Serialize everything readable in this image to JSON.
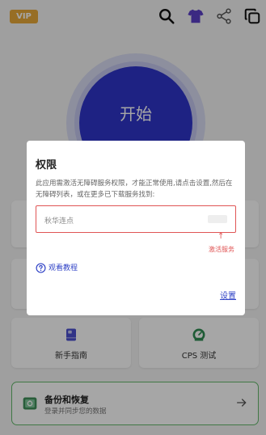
{
  "header": {
    "vip_label": "VIP",
    "icons": [
      "search-icon",
      "shirt-icon",
      "share-icon",
      "copy-icon"
    ]
  },
  "main": {
    "start_label": "开始"
  },
  "cards": {
    "guide_label": "新手指南",
    "cps_label": "CPS 测试"
  },
  "backup": {
    "title": "备份和恢复",
    "subtitle": "登录并同步您的数据"
  },
  "dialog": {
    "title": "权限",
    "message": "此应用需激活无障碍服务权限，才能正常使用,请点击设置,然后在无障碍列表，或在更多已下载服务找到:",
    "service_name": "秋华连点",
    "hint_arrow": "↑",
    "hint_label": "激活服务",
    "tutorial_label": "观看教程",
    "settings_label": "设置"
  },
  "colors": {
    "vip": "#e8a93a",
    "primary": "#2f35c9",
    "link": "#3345c7",
    "alert": "#e05555",
    "accent_green": "#63b96b",
    "shirt": "#5b3fc8"
  }
}
